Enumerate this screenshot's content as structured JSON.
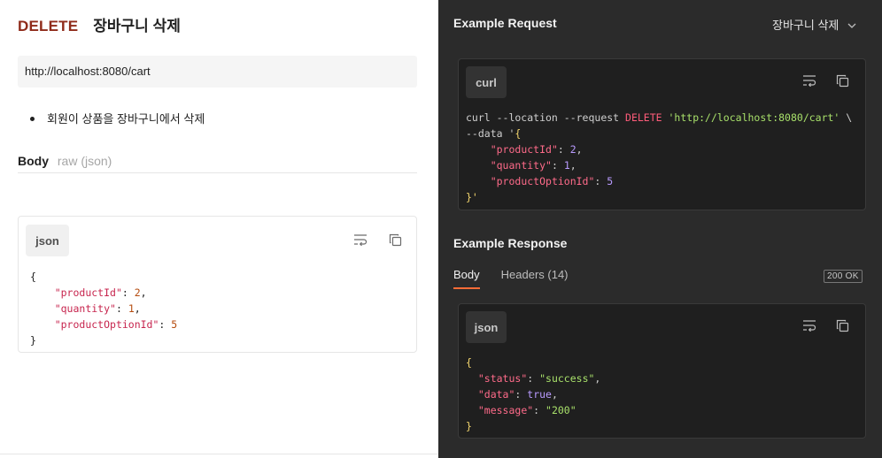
{
  "request": {
    "method": "DELETE",
    "name": "장바구니 삭제",
    "url": "http://localhost:8080/cart",
    "description_items": [
      "회원이 상품을 장바구니에서 삭제"
    ],
    "body_label": "Body",
    "body_type": "raw (json)",
    "body_lang": "json",
    "body_code": {
      "open": "{",
      "lines": [
        {
          "key": "\"productId\"",
          "value": "2",
          "sep": ","
        },
        {
          "key": "\"quantity\"",
          "value": "1",
          "sep": ","
        },
        {
          "key": "\"productOptionId\"",
          "value": "5",
          "sep": ""
        }
      ],
      "close": "}"
    }
  },
  "example_request": {
    "title": "Example Request",
    "selected_example": "장바구니 삭제",
    "lang": "curl",
    "curl_prefix": "curl --location --request ",
    "curl_method": "DELETE",
    "curl_url": "'http://localhost:8080/cart'",
    "curl_cont": " \\",
    "data_prefix": "--data '",
    "open_brace": "{",
    "lines": [
      {
        "key": "\"productId\"",
        "value": "2",
        "sep": ","
      },
      {
        "key": "\"quantity\"",
        "value": "1",
        "sep": ","
      },
      {
        "key": "\"productOptionId\"",
        "value": "5",
        "sep": ""
      }
    ],
    "close": "}'"
  },
  "example_response": {
    "title": "Example Response",
    "tabs": [
      "Body",
      "Headers (14)"
    ],
    "status": "200 OK",
    "lang": "json",
    "open": "{",
    "lines": [
      {
        "key": "\"status\"",
        "value": "\"success\"",
        "type": "str",
        "sep": ","
      },
      {
        "key": "\"data\"",
        "value": "true",
        "type": "bool",
        "sep": ","
      },
      {
        "key": "\"message\"",
        "value": "\"200\"",
        "type": "str",
        "sep": ""
      }
    ],
    "close": "}"
  },
  "icons": [
    "wrap-lines-icon",
    "copy-icon",
    "chevron-down-icon"
  ],
  "colors": {
    "method": "#8f2b1a",
    "accent_tab": "#ff6c37",
    "dark_bg": "#2b2b2b"
  }
}
